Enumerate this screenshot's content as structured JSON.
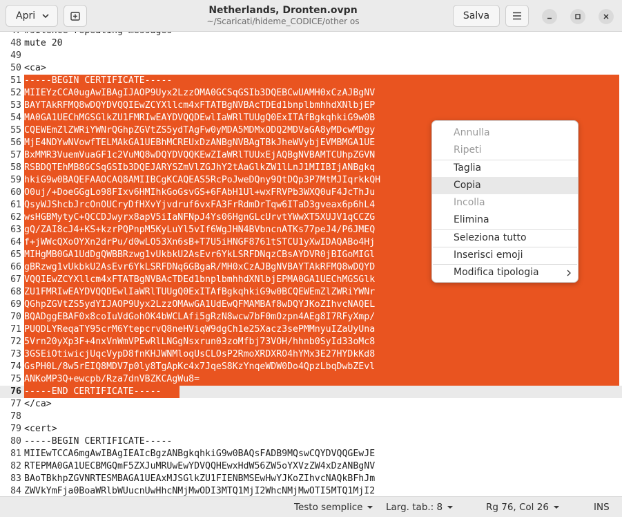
{
  "header": {
    "open_label": "Apri",
    "title": "Netherlands, Dronten.ovpn",
    "subtitle": "~/Scaricati/hideme_CODICE/other os",
    "save_label": "Salva"
  },
  "editor": {
    "lines": [
      {
        "num": "47",
        "text": "#silence repeating messages"
      },
      {
        "num": "48",
        "text": "mute 20"
      },
      {
        "num": "49",
        "text": ""
      },
      {
        "num": "50",
        "text": "<ca>"
      },
      {
        "num": "51",
        "text": "-----BEGIN CERTIFICATE-----"
      },
      {
        "num": "52",
        "text": "MIIEYzCCA0ugAwIBAgIJAOP9Uyx2LzzOMA0GCSqGSIb3DQEBCwUAMH0xCzAJBgNV"
      },
      {
        "num": "53",
        "text": "BAYTAkRFMQ8wDQYDVQQIEwZCYXllcm4xFTATBgNVBAcTDEd1bnplbmhhdXNlbjEP"
      },
      {
        "num": "54",
        "text": "MA0GA1UEChMGSGlkZU1FMRIwEAYDVQQDEwlIaWRlTUUgQ0ExITAfBgkqhkiG9w0B"
      },
      {
        "num": "55",
        "text": "CQEWEmZlZWRiYWNrQGhpZGVtZS5ydTAgFw0yMDA5MDMxODQ2MDVaGA8yMDcwMDgy"
      },
      {
        "num": "56",
        "text": "MjE4NDYwNVowfTELMAkGA1UEBhMCREUxDzANBgNVBAgTBkJheWVybjEVMBMGA1UE"
      },
      {
        "num": "57",
        "text": "BxMMR3VuemVuaGF1c2VuMQ8wDQYDVQQKEwZIaWRlTUUxEjAQBgNVBAMTCUhpZGVN"
      },
      {
        "num": "58",
        "text": "RSBDQTEhMB8GCSqGSIb3DQEJARYSZmVlZGJhY2tAaGlkZW1lLnJ1MIIBIjANBgkq"
      },
      {
        "num": "59",
        "text": "hkiG9w0BAQEFAAOCAQ8AMIIBCgKCAQEAS5RcPoJweDQny9QtDQp3P7MtMJIqrkkQH"
      },
      {
        "num": "60",
        "text": "O0uj/+DoeGGgLo98FIxv6HMIhkGoGsvGS+6FAbH1Ul+wxFRVPb3WXQ0uF4JcThJu"
      },
      {
        "num": "61",
        "text": "QsyWJShcbJrcOnOUCryDfHXvYjvdruf6vxFA3FrRdmDrTqw6ITaD3gveax6p6hL4"
      },
      {
        "num": "62",
        "text": "wsHGBMytyC+QCCDJwyrx8apV5iIaNFNpJ4Ys06HgnGLcUrvtYWwXT5XUJV1qCCZG"
      },
      {
        "num": "63",
        "text": "gQ/ZAI8cJ4+KS+kzrPQPnpM5KyLuYl5vIf6WgJHN4BVbncnATKs77peJ4/P6JMEQ"
      },
      {
        "num": "64",
        "text": "f+jWWcQXoOYXn2drPu/d0wLO53Xn6sB+T7U5iHNGF8761tSTCU1yXwIDAQABo4Hj"
      },
      {
        "num": "65",
        "text": "MIHgMB0GA1UdDgQWBBRzwg1vUkbkU2AsEvr6YkLSRFDNqzCBsAYDVR0jBIGoMIGl"
      },
      {
        "num": "66",
        "text": "gBRzwg1vUkbkU2AsEvr6YkLSRFDNq6GBgaR/MH0xCzAJBgNVBAYTAkRFMQ8wDQYD"
      },
      {
        "num": "67",
        "text": "VQQIEwZCYXllcm4xFTATBgNVBAcTDEd1bnplbmhhdXNlbjEPMA0GA1UEChMGSGlk"
      },
      {
        "num": "68",
        "text": "ZU1FMRIwEAYDVQQDEwlIaWRlTUUgQ0ExITAfBgkqhkiG9w0BCQEWEmZlZWRiYWNr"
      },
      {
        "num": "69",
        "text": "QGhpZGVtZS5ydYIJAOP9Uyx2LzzOMAwGA1UdEwQFMAMBAf8wDQYJKoZIhvcNAQEL"
      },
      {
        "num": "70",
        "text": "BQADggEBAF0x8coIuVdGohOK4bWCLAfi5gRzN8wcw7bF0mOzpn4AEg8I7RFyXmp/"
      },
      {
        "num": "71",
        "text": "PUQDLYReqaTY95crM6YtepcrvQ8neHViqW9dgCh1e25Xacz3sePMMnyuIZaUyUna"
      },
      {
        "num": "72",
        "text": "5Vrn20yXp3F+4nxVnWmVPEwRlLNGgNsxrun03zoMfbj73VOH/hhnb0SyId33oMc8"
      },
      {
        "num": "73",
        "text": "3GSEiOtiwicjUqcVypD8fnKHJWNMloqUsCLOsP2RmoXRDXRO4hYMx3E27HYDkKd8"
      },
      {
        "num": "74",
        "text": "GsPH0L/8w5rEIQ8MDV7p0ly8TgApKc4x7JqeS8KzYnqeWDW0Do4QpzLbqDwbZEvl"
      },
      {
        "num": "75",
        "text": "ANKoMP3Q+ewcpb/Rza7dnVBZKCAgWu8="
      },
      {
        "num": "76",
        "text": "-----END CERTIFICATE-----"
      },
      {
        "num": "77",
        "text": "</ca>"
      },
      {
        "num": "78",
        "text": ""
      },
      {
        "num": "79",
        "text": "<cert>"
      },
      {
        "num": "80",
        "text": "-----BEGIN CERTIFICATE-----"
      },
      {
        "num": "81",
        "text": "MIIEwTCCA6mgAwIBAgIEAIcBgzANBgkqhkiG9w0BAQsFADB9MQswCQYDVQQGEwJE"
      },
      {
        "num": "82",
        "text": "RTEPMA0GA1UECBMGQmF5ZXJuMRUwEwYDVQQHEwxHdW56ZW5oYXVzZW4xDzANBgNV"
      },
      {
        "num": "83",
        "text": "BAoTBkhpZGVNRTESMBAGA1UEAxMJSGlkZU1FIENBMSEwHwYJKoZIhvcNAQkBFhJm"
      },
      {
        "num": "84",
        "text": "ZWVkYmFja0BoaWRlbWUucnUwHhcNMjMwODI3MTQ1MjI2WhcNMjMwOTI5MTQ1MjI2"
      }
    ]
  },
  "context_menu": {
    "items": [
      {
        "label": "Annulla",
        "disabled": true
      },
      {
        "label": "Ripeti",
        "disabled": true
      },
      {
        "label": "Taglia",
        "disabled": false
      },
      {
        "label": "Copia",
        "disabled": false
      },
      {
        "label": "Incolla",
        "disabled": true
      },
      {
        "label": "Elimina",
        "disabled": false
      },
      {
        "label": "Seleziona tutto",
        "disabled": false
      },
      {
        "label": "Inserisci emoji",
        "disabled": false
      },
      {
        "label": "Modifica tipologia",
        "disabled": false
      }
    ]
  },
  "statusbar": {
    "syntax": "Testo semplice",
    "tab_width": "Larg. tab.: 8",
    "position": "Rg 76, Col 26",
    "mode": "INS"
  },
  "colors": {
    "selection": "#e95420",
    "current_line": "#eaeaea",
    "header_bg": "#ebebeb"
  }
}
